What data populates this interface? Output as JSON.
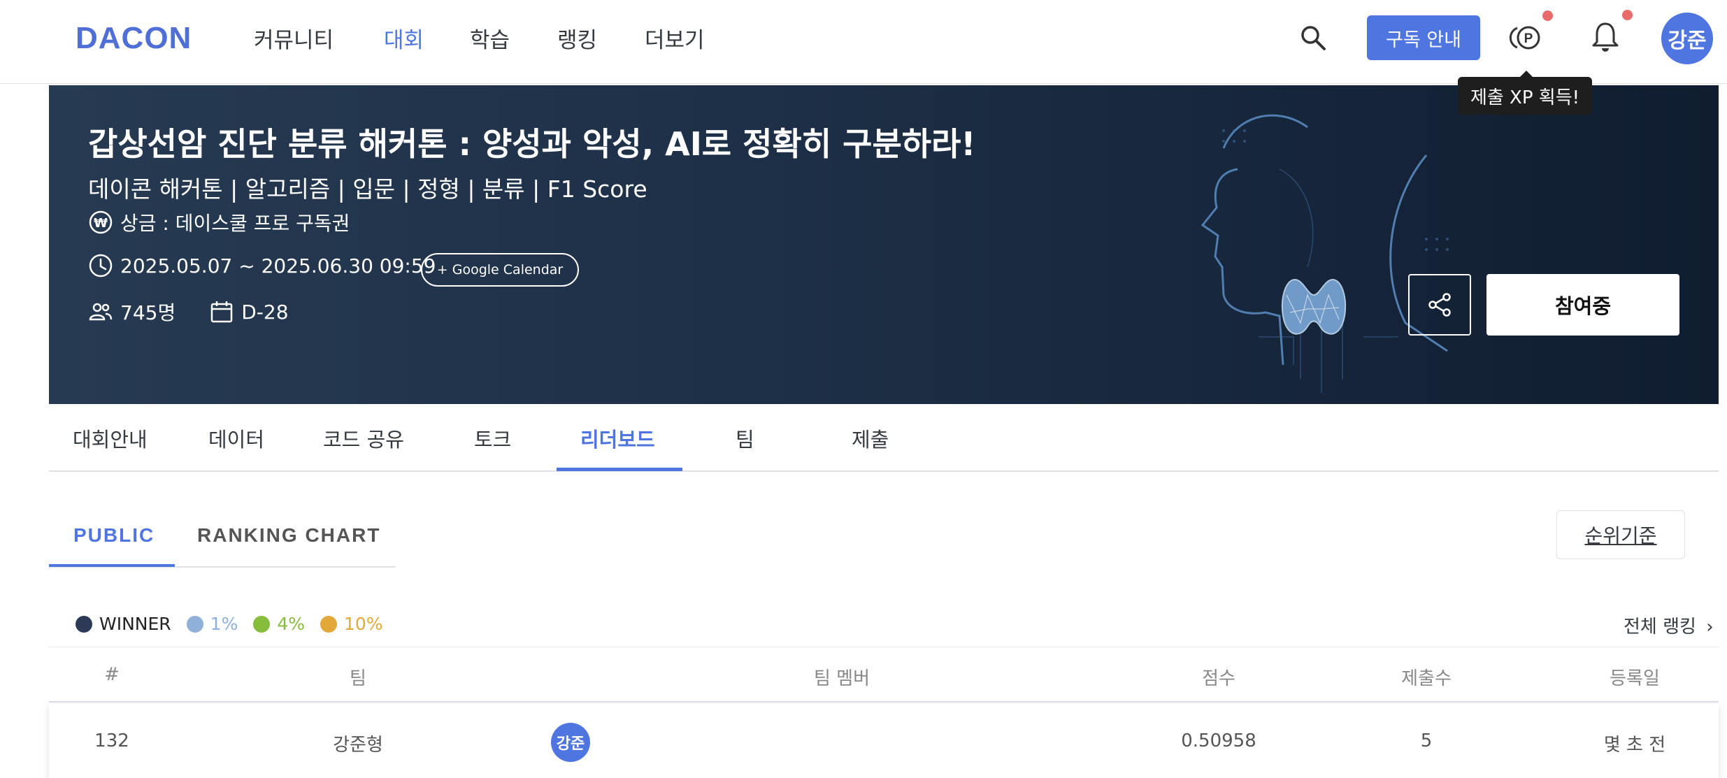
{
  "nav": {
    "logo": "DACON",
    "items": [
      "커뮤니티",
      "대회",
      "학습",
      "랭킹",
      "더보기"
    ],
    "subscribe_label": "구독 안내",
    "avatar_text": "강준",
    "tooltip": "제출 XP 획득!"
  },
  "hero": {
    "title": "갑상선암 진단 분류 해커톤 : 양성과 악성, AI로 정확히 구분하라!",
    "subtitle": "데이콘 해커톤 | 알고리즘 | 입문 | 정형 | 분류 | F1 Score",
    "prize": "상금 : 데이스쿨 프로 구독권",
    "period": "2025.05.07 ~ 2025.06.30 09:59",
    "calendar_label": "+ Google Calendar",
    "participants": "745명",
    "dday": "D-28",
    "join_label": "참여중"
  },
  "tabs": [
    "대회안내",
    "데이터",
    "코드 공유",
    "토크",
    "리더보드",
    "팀",
    "제출"
  ],
  "subtabs": [
    "PUBLIC",
    "RANKING CHART"
  ],
  "criteria_label": "순위기준",
  "legend": [
    {
      "label": "WINNER",
      "color": "#2c3a55"
    },
    {
      "label": "1%",
      "color": "#8fb0d8"
    },
    {
      "label": "4%",
      "color": "#86bd3d"
    },
    {
      "label": "10%",
      "color": "#e2a93a"
    }
  ],
  "full_ranking_label": "전체 랭킹",
  "table": {
    "headers": [
      "#",
      "팀",
      "팀 멤버",
      "점수",
      "제출수",
      "등록일"
    ],
    "rows": [
      {
        "rank": "132",
        "team": "강준형",
        "member": "강준",
        "score": "0.50958",
        "submissions": "5",
        "date": "몇 초 전"
      }
    ]
  }
}
